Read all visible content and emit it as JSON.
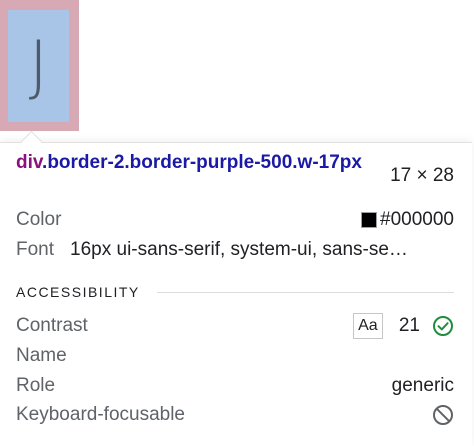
{
  "preview": {
    "letter": "J"
  },
  "tooltip": {
    "selector_tag": "div",
    "selector_classes": ".border-2.border-purple-500.w-17px",
    "dimensions": "17 × 28",
    "color": {
      "label": "Color",
      "value": "#000000",
      "swatch": "#000000"
    },
    "font": {
      "label": "Font",
      "value": "16px ui-sans-serif, system-ui, sans-se…"
    },
    "accessibility": {
      "header": "ACCESSIBILITY",
      "contrast": {
        "label": "Contrast",
        "sample": "Aa",
        "value": "21",
        "status_icon": "check-circle-icon",
        "status_color": "#1e8e3e"
      },
      "name": {
        "label": "Name",
        "value": ""
      },
      "role": {
        "label": "Role",
        "value": "generic"
      },
      "keyboard": {
        "label": "Keyboard-focusable",
        "status_icon": "no-entry-icon"
      }
    }
  }
}
